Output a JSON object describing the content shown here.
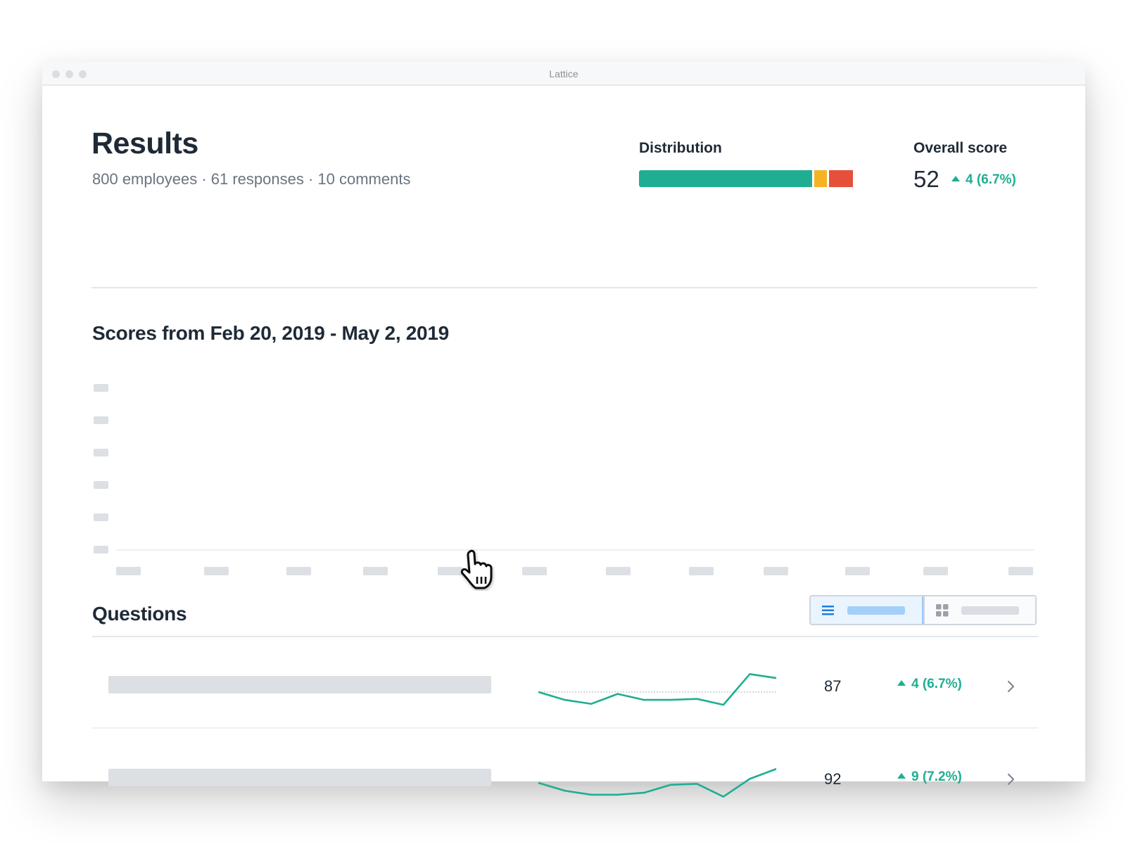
{
  "window": {
    "title": "Lattice",
    "traffic_lights": [
      "close",
      "minimize",
      "maximize"
    ]
  },
  "header": {
    "title": "Results",
    "subtitle": "800 employees · 61 responses · 10 comments",
    "distribution": {
      "label": "Distribution",
      "segments": [
        {
          "name": "positive",
          "fraction": 0.81,
          "color": "#1fae93"
        },
        {
          "name": "neutral",
          "fraction": 0.06,
          "color": "#f5b324"
        },
        {
          "name": "negative",
          "fraction": 0.11,
          "color": "#e4503a"
        }
      ]
    },
    "overall": {
      "label": "Overall score",
      "score": "52",
      "delta": "4 (6.7%)",
      "delta_direction": "up"
    }
  },
  "scores_chart": {
    "title": "Scores from Feb 20, 2019 - May 2, 2019",
    "loading": true,
    "y_tick_placeholders": 6,
    "x_tick_placeholders": 12
  },
  "questions": {
    "title": "Questions",
    "view_toggle": {
      "options": [
        {
          "name": "list",
          "icon": "list-icon",
          "active": true
        },
        {
          "name": "grid",
          "icon": "grid-icon",
          "active": false
        }
      ]
    },
    "rows": [
      {
        "score": "87",
        "delta": "4 (6.7%)",
        "delta_direction": "up",
        "trend": [
          50,
          46,
          44,
          49,
          46,
          46,
          46.5,
          43.5,
          59,
          57
        ],
        "baseline": 50
      },
      {
        "score": "92",
        "delta": "9 (7.2%)",
        "delta_direction": "up",
        "trend": [
          51,
          47,
          45,
          45,
          46,
          50,
          50.5,
          44,
          53,
          58
        ],
        "baseline": 50
      }
    ]
  },
  "colors": {
    "accent_green": "#1fae93",
    "text_dark": "#1f2a37",
    "text_muted": "#6b7480",
    "placeholder": "#dcdfe3",
    "toggle_active": "#a4cff7"
  }
}
